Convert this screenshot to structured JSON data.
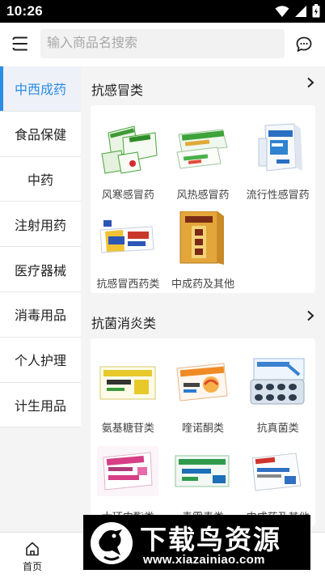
{
  "status_bar": {
    "time": "10:26",
    "icons": [
      "wifi-icon",
      "signal-icon",
      "battery-icon"
    ]
  },
  "header": {
    "search_placeholder": "输入商品名搜索"
  },
  "sidebar": {
    "items": [
      {
        "label": "中西成药",
        "active": true
      },
      {
        "label": "食品保健"
      },
      {
        "label": "中药"
      },
      {
        "label": "注射用药"
      },
      {
        "label": "医疗器械"
      },
      {
        "label": "消毒用品"
      },
      {
        "label": "个人护理"
      },
      {
        "label": "计生用品"
      }
    ]
  },
  "sections": [
    {
      "title": "抗感冒类",
      "products": [
        {
          "name": "风寒感冒药"
        },
        {
          "name": "风热感冒药"
        },
        {
          "name": "流行性感冒药"
        },
        {
          "name": "抗感冒西药类"
        },
        {
          "name": "中成药及其他"
        }
      ]
    },
    {
      "title": "抗菌消炎类",
      "products": [
        {
          "name": "氨基糖苷类"
        },
        {
          "name": "喹诺酮类"
        },
        {
          "name": "抗真菌类"
        },
        {
          "name": "大环内酯类"
        },
        {
          "name": "青霉素类"
        },
        {
          "name": "中成药及其他"
        }
      ]
    }
  ],
  "bottom_nav": {
    "home_label": "首页"
  },
  "watermark": {
    "title": "下载鸟资源",
    "url": "www.xiazainiao.com"
  },
  "colors": {
    "accent": "#2b8de6",
    "active_bg": "#eef1f8",
    "page_bg": "#f4f4f4"
  }
}
